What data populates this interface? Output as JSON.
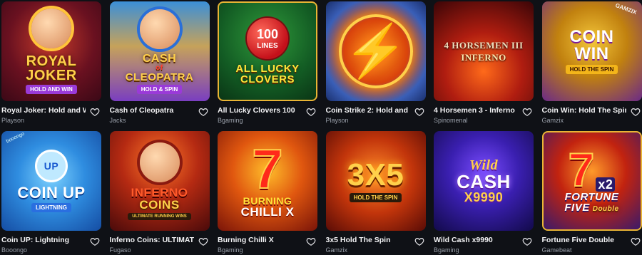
{
  "games": [
    {
      "title": "Royal Joker: Hold and Win",
      "provider": "Playson",
      "art": [
        "ROYAL",
        "JOKER"
      ],
      "banner": "HOLD AND WIN",
      "theme": "t-royal"
    },
    {
      "title": "Cash of Cleopatra",
      "provider": "Jacks",
      "art": [
        "CASH",
        "of",
        "CLEOPATRA"
      ],
      "banner": "HOLD & SPIN",
      "theme": "t-cleo"
    },
    {
      "title": "All Lucky Clovers 100",
      "provider": "Bgaming",
      "art": [
        "100",
        "LINES"
      ],
      "art2": [
        "ALL LUCKY",
        "CLOVERS"
      ],
      "theme": "t-clover"
    },
    {
      "title": "Coin Strike 2: Hold and ...",
      "provider": "Playson",
      "theme": "t-strike"
    },
    {
      "title": "4 Horsemen 3 - Inferno",
      "provider": "Spinomenal",
      "art": [
        "4 HORSEMEN III",
        "INFERNO"
      ],
      "theme": "t-horse"
    },
    {
      "title": "Coin Win: Hold The Spin",
      "provider": "Gamzix",
      "art": [
        "COIN",
        "WIN"
      ],
      "banner": "HOLD THE SPIN",
      "badge": "GAMZIX",
      "theme": "t-coinwin"
    },
    {
      "title": "Coin UP: Lightning",
      "provider": "Booongo",
      "art": [
        "UP",
        "COIN UP"
      ],
      "banner": "LIGHTNING",
      "badge": "booongo",
      "theme": "t-coinup"
    },
    {
      "title": "Inferno Coins: ULTIMATE ...",
      "provider": "Fugaso",
      "art": [
        "INFERNO",
        "COINS"
      ],
      "banner": "ULTIMATE  RUNNING WINS",
      "theme": "t-inferno"
    },
    {
      "title": "Burning Chilli X",
      "provider": "Bgaming",
      "art": [
        "7"
      ],
      "art2": [
        "BURNING",
        "CHILLI X"
      ],
      "theme": "t-chilli"
    },
    {
      "title": "3x5 Hold The Spin",
      "provider": "Gamzix",
      "art": [
        "3X5"
      ],
      "banner": "HOLD THE SPIN",
      "theme": "t-3x5"
    },
    {
      "title": "Wild Cash x9990",
      "provider": "Bgaming",
      "art": [
        "Wild",
        "CASH",
        "X9990"
      ],
      "theme": "t-wild"
    },
    {
      "title": "Fortune Five Double",
      "provider": "Gamebeat",
      "art": [
        "7",
        "x2"
      ],
      "art2": [
        "FORTUNE",
        "FIVE",
        "Double"
      ],
      "theme": "t-fortune"
    }
  ],
  "colors": {
    "background": "#0f1116",
    "title": "#f4f4f6",
    "provider": "#9aa0aa"
  },
  "icons": {
    "favorite": "heart-outline-icon"
  }
}
